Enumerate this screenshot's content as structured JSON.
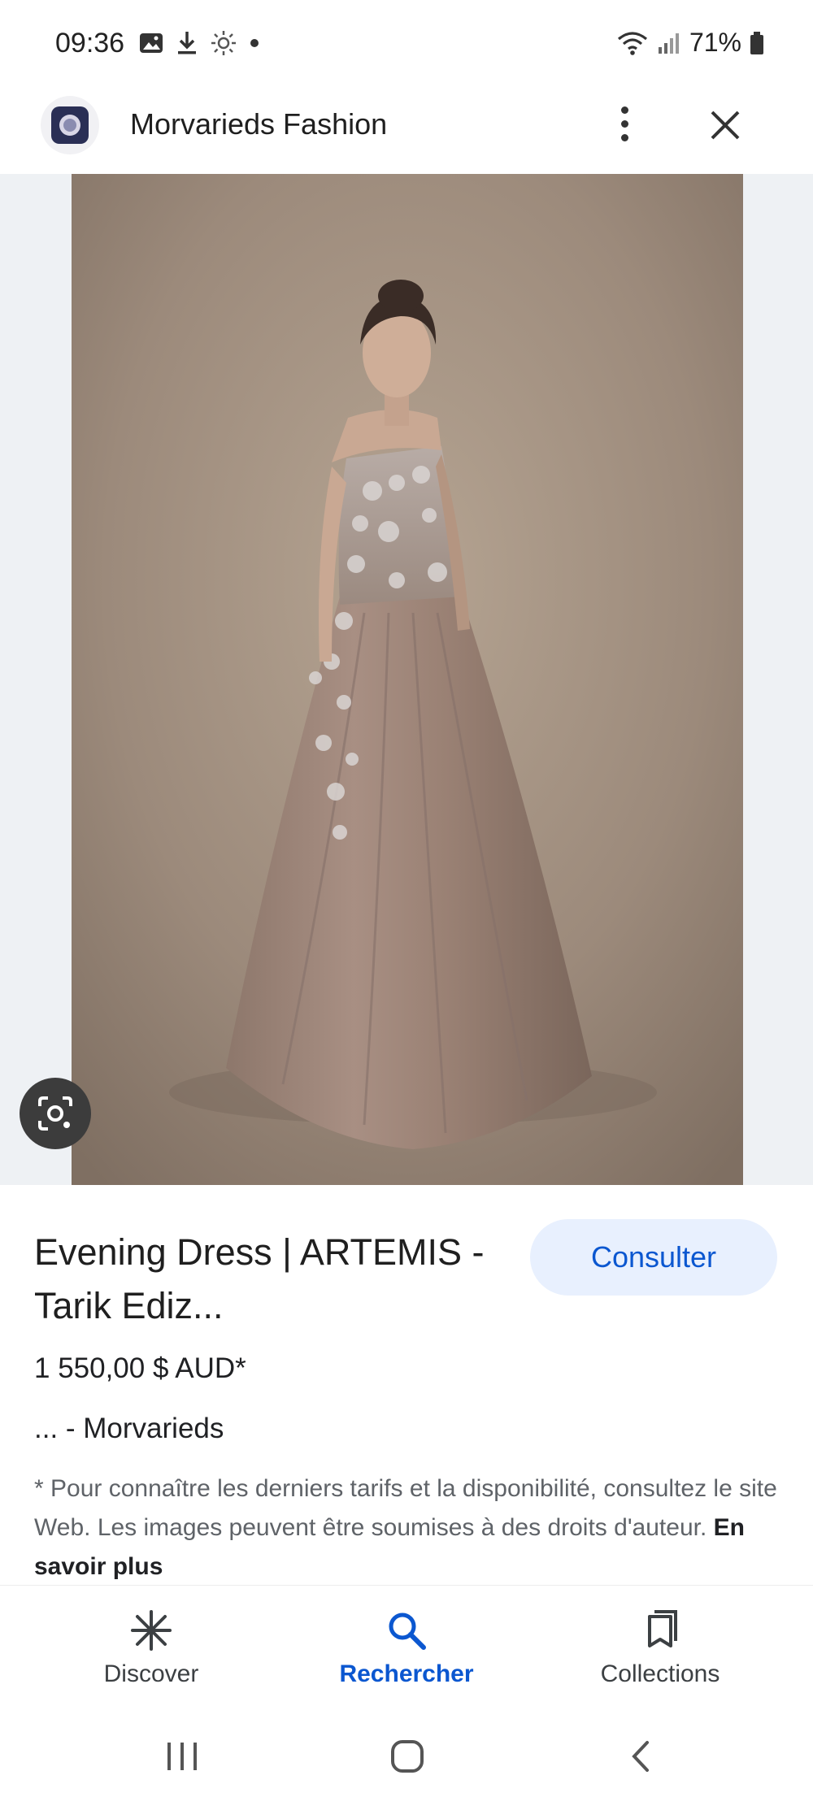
{
  "status_bar": {
    "time": "09:36",
    "battery": "71%",
    "left_icons": [
      "image-icon",
      "download-icon",
      "brightness-icon",
      "dot-icon"
    ],
    "right_icons": [
      "wifi-icon",
      "signal-icon",
      "battery-icon"
    ]
  },
  "header": {
    "site_name": "Morvarieds Fashion",
    "logo_icon": "site-logo-icon",
    "menu_icon": "more-vert-icon",
    "close_icon": "close-icon"
  },
  "product": {
    "title": "Evening Dress | ARTEMIS - Tarik Ediz...",
    "price": "1 550,00 $ AUD*",
    "source": "... - Morvarieds",
    "visit_label": "Consulter",
    "disclaimer": "* Pour connaître les derniers tarifs et la disponibilité, consultez le site Web. Les images peuvent être soumises à des droits d'auteur.",
    "learn_more": "En savoir plus",
    "lens_icon": "lens-icon"
  },
  "bottom_nav": {
    "items": [
      {
        "label": "Discover",
        "icon": "asterisk-icon",
        "active": false
      },
      {
        "label": "Rechercher",
        "icon": "search-icon",
        "active": true
      },
      {
        "label": "Collections",
        "icon": "collections-icon",
        "active": false
      }
    ]
  },
  "system_nav": [
    "recents-icon",
    "home-icon",
    "back-icon"
  ],
  "colors": {
    "accent": "#0b57d0",
    "button_bg": "#e8f0fe",
    "image_backdrop": "#eef1f4",
    "photo_bg": "#9c8a7b"
  }
}
